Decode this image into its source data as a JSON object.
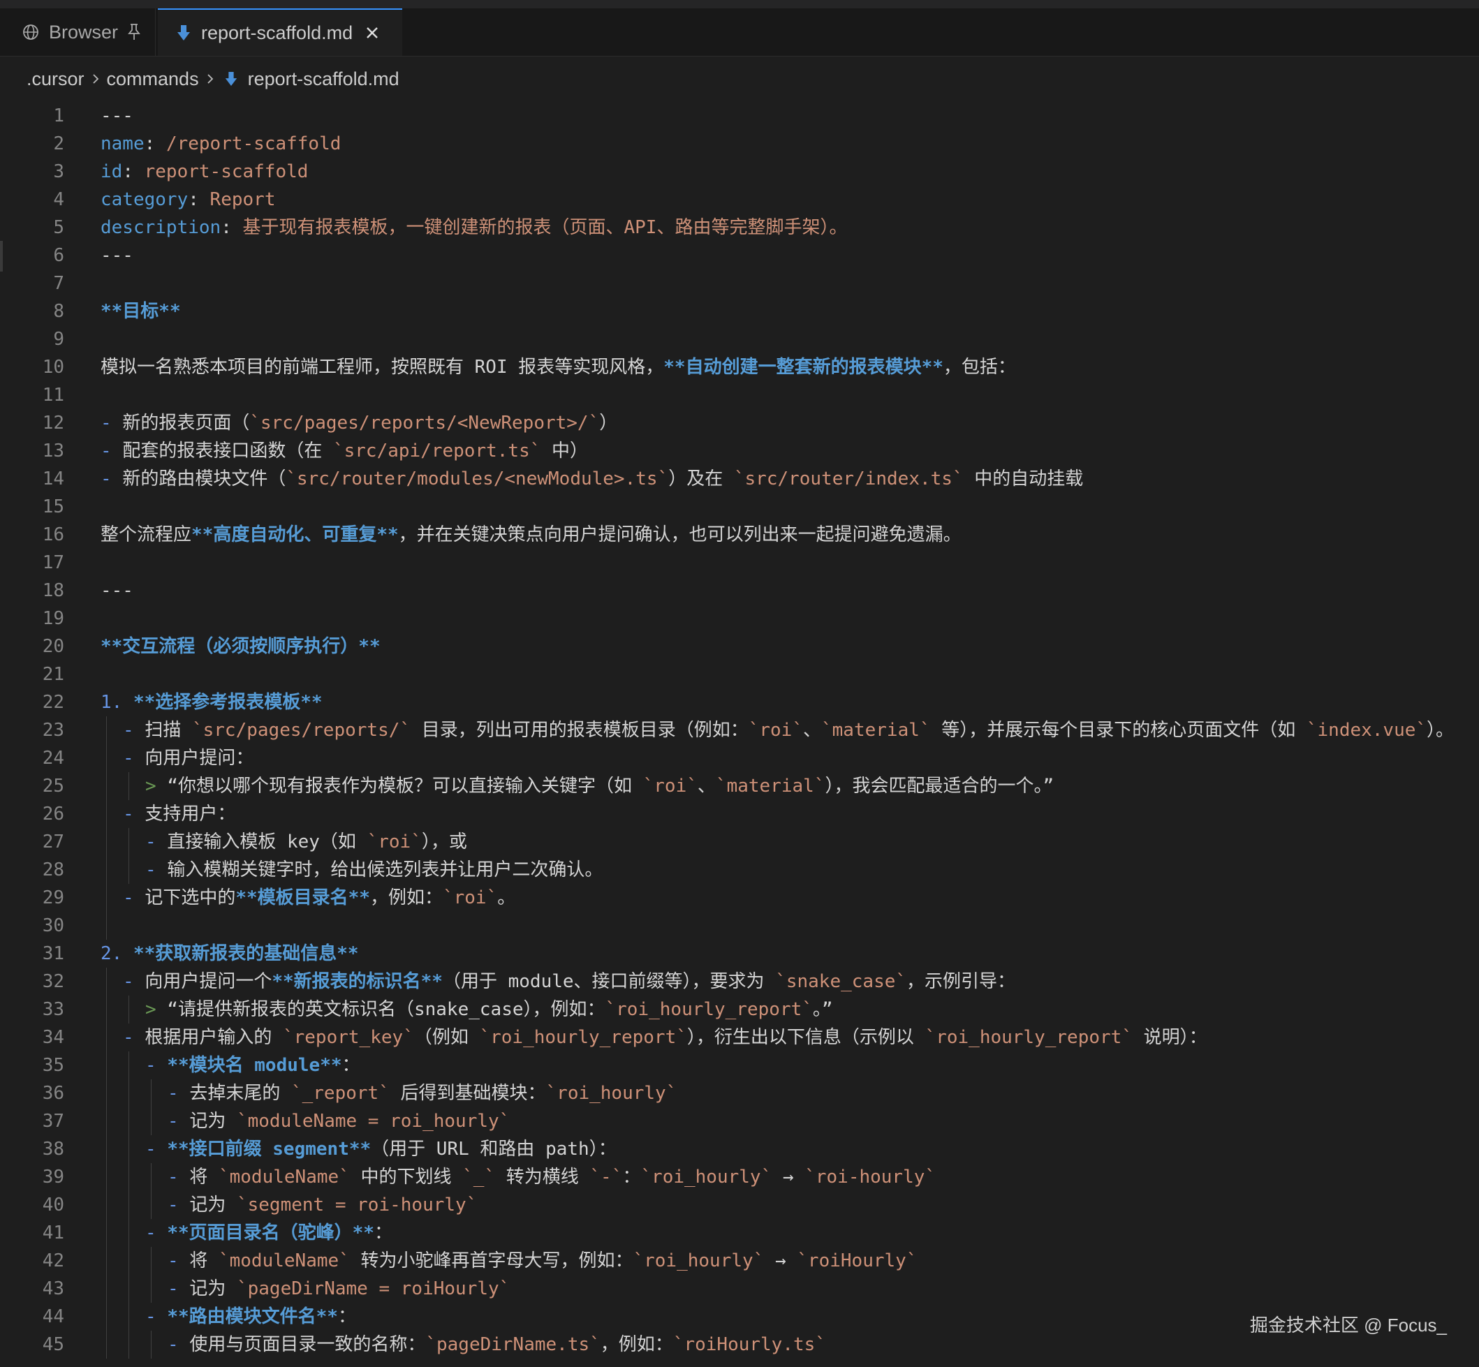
{
  "tabs": [
    {
      "label": "Browser",
      "icon": "globe-icon",
      "pinned": true,
      "active": false
    },
    {
      "label": "report-scaffold.md",
      "icon": "markdown-icon",
      "active": true
    }
  ],
  "breadcrumb": [
    ".cursor",
    "commands",
    "report-scaffold.md"
  ],
  "watermark": "掘金技术社区 @ Focus_",
  "colors": {
    "background": "#1e1e1e",
    "keyword": "#569cd6",
    "string": "#ce9178",
    "line_number": "#858585",
    "blockquote": "#6a9955",
    "active_tab_border": "#3794ff"
  },
  "lines": [
    {
      "n": "1",
      "indent": 0,
      "segs": [
        {
          "t": "---",
          "c": "plain"
        }
      ]
    },
    {
      "n": "2",
      "indent": 0,
      "segs": [
        {
          "t": "name",
          "c": "key"
        },
        {
          "t": ": ",
          "c": "plain"
        },
        {
          "t": "/report-scaffold",
          "c": "str"
        }
      ]
    },
    {
      "n": "3",
      "indent": 0,
      "segs": [
        {
          "t": "id",
          "c": "key"
        },
        {
          "t": ": ",
          "c": "plain"
        },
        {
          "t": "report-scaffold",
          "c": "str"
        }
      ]
    },
    {
      "n": "4",
      "indent": 0,
      "segs": [
        {
          "t": "category",
          "c": "key"
        },
        {
          "t": ": ",
          "c": "plain"
        },
        {
          "t": "Report",
          "c": "str"
        }
      ]
    },
    {
      "n": "5",
      "indent": 0,
      "segs": [
        {
          "t": "description",
          "c": "key"
        },
        {
          "t": ": ",
          "c": "plain"
        },
        {
          "t": "基于现有报表模板，一键创建新的报表（页面、API、路由等完整脚手架）。",
          "c": "str"
        }
      ]
    },
    {
      "n": "6",
      "indent": 0,
      "segs": [
        {
          "t": "---",
          "c": "plain"
        }
      ]
    },
    {
      "n": "7",
      "indent": 0,
      "segs": []
    },
    {
      "n": "8",
      "indent": 0,
      "segs": [
        {
          "t": "**目标**",
          "c": "bold"
        }
      ]
    },
    {
      "n": "9",
      "indent": 0,
      "segs": []
    },
    {
      "n": "10",
      "indent": 0,
      "segs": [
        {
          "t": "模拟一名熟悉本项目的前端工程师，按照既有 ROI 报表等实现风格，",
          "c": "plain"
        },
        {
          "t": "**自动创建一整套新的报表模块**",
          "c": "bold"
        },
        {
          "t": "，包括：",
          "c": "plain"
        }
      ]
    },
    {
      "n": "11",
      "indent": 0,
      "segs": []
    },
    {
      "n": "12",
      "indent": 0,
      "segs": [
        {
          "t": "- ",
          "c": "dash"
        },
        {
          "t": "新的报表页面（",
          "c": "plain"
        },
        {
          "t": "`src/pages/reports/<NewReport>/`",
          "c": "code"
        },
        {
          "t": "）",
          "c": "plain"
        }
      ]
    },
    {
      "n": "13",
      "indent": 0,
      "segs": [
        {
          "t": "- ",
          "c": "dash"
        },
        {
          "t": "配套的报表接口函数（在 ",
          "c": "plain"
        },
        {
          "t": "`src/api/report.ts`",
          "c": "code"
        },
        {
          "t": " 中）",
          "c": "plain"
        }
      ]
    },
    {
      "n": "14",
      "indent": 0,
      "segs": [
        {
          "t": "- ",
          "c": "dash"
        },
        {
          "t": "新的路由模块文件（",
          "c": "plain"
        },
        {
          "t": "`src/router/modules/<newModule>.ts`",
          "c": "code"
        },
        {
          "t": "）及在 ",
          "c": "plain"
        },
        {
          "t": "`src/router/index.ts`",
          "c": "code"
        },
        {
          "t": " 中的自动挂载",
          "c": "plain"
        }
      ]
    },
    {
      "n": "15",
      "indent": 0,
      "segs": []
    },
    {
      "n": "16",
      "indent": 0,
      "segs": [
        {
          "t": "整个流程应",
          "c": "plain"
        },
        {
          "t": "**高度自动化、可重复**",
          "c": "bold"
        },
        {
          "t": "，并在关键决策点向用户提问确认，也可以列出来一起提问避免遗漏。",
          "c": "plain"
        }
      ]
    },
    {
      "n": "17",
      "indent": 0,
      "segs": []
    },
    {
      "n": "18",
      "indent": 0,
      "segs": [
        {
          "t": "---",
          "c": "plain"
        }
      ]
    },
    {
      "n": "19",
      "indent": 0,
      "segs": []
    },
    {
      "n": "20",
      "indent": 0,
      "segs": [
        {
          "t": "**交互流程（必须按顺序执行）**",
          "c": "bold"
        }
      ]
    },
    {
      "n": "21",
      "indent": 0,
      "segs": []
    },
    {
      "n": "22",
      "indent": 0,
      "segs": [
        {
          "t": "1. ",
          "c": "dash"
        },
        {
          "t": "**选择参考报表模板**",
          "c": "bold"
        }
      ]
    },
    {
      "n": "23",
      "indent": 1,
      "segs": [
        {
          "t": "- ",
          "c": "dash"
        },
        {
          "t": "扫描 ",
          "c": "plain"
        },
        {
          "t": "`src/pages/reports/`",
          "c": "code"
        },
        {
          "t": " 目录，列出可用的报表模板目录（例如：",
          "c": "plain"
        },
        {
          "t": "`roi`",
          "c": "code"
        },
        {
          "t": "、",
          "c": "plain"
        },
        {
          "t": "`material`",
          "c": "code"
        },
        {
          "t": " 等），并展示每个目录下的核心页面文件（如 ",
          "c": "plain"
        },
        {
          "t": "`index.vue`",
          "c": "code"
        },
        {
          "t": "）。",
          "c": "plain"
        }
      ]
    },
    {
      "n": "24",
      "indent": 1,
      "segs": [
        {
          "t": "- ",
          "c": "dash"
        },
        {
          "t": "向用户提问：",
          "c": "plain"
        }
      ]
    },
    {
      "n": "25",
      "indent": 2,
      "segs": [
        {
          "t": "> ",
          "c": "quote"
        },
        {
          "t": "“你想以哪个现有报表作为模板？可以直接输入关键字（如 ",
          "c": "plain"
        },
        {
          "t": "`roi`",
          "c": "code"
        },
        {
          "t": "、",
          "c": "plain"
        },
        {
          "t": "`material`",
          "c": "code"
        },
        {
          "t": "），我会匹配最适合的一个。”",
          "c": "plain"
        }
      ]
    },
    {
      "n": "26",
      "indent": 1,
      "segs": [
        {
          "t": "- ",
          "c": "dash"
        },
        {
          "t": "支持用户：",
          "c": "plain"
        }
      ]
    },
    {
      "n": "27",
      "indent": 2,
      "segs": [
        {
          "t": "- ",
          "c": "dash"
        },
        {
          "t": "直接输入模板 key（如 ",
          "c": "plain"
        },
        {
          "t": "`roi`",
          "c": "code"
        },
        {
          "t": "），或",
          "c": "plain"
        }
      ]
    },
    {
      "n": "28",
      "indent": 2,
      "segs": [
        {
          "t": "- ",
          "c": "dash"
        },
        {
          "t": "输入模糊关键字时，给出候选列表并让用户二次确认。",
          "c": "plain"
        }
      ]
    },
    {
      "n": "29",
      "indent": 1,
      "segs": [
        {
          "t": "- ",
          "c": "dash"
        },
        {
          "t": "记下选中的",
          "c": "plain"
        },
        {
          "t": "**模板目录名**",
          "c": "bold"
        },
        {
          "t": "，例如：",
          "c": "plain"
        },
        {
          "t": "`roi`",
          "c": "code"
        },
        {
          "t": "。",
          "c": "plain"
        }
      ]
    },
    {
      "n": "30",
      "indent": 1,
      "segs": []
    },
    {
      "n": "31",
      "indent": 0,
      "segs": [
        {
          "t": "2. ",
          "c": "dash"
        },
        {
          "t": "**获取新报表的基础信息**",
          "c": "bold"
        }
      ]
    },
    {
      "n": "32",
      "indent": 1,
      "segs": [
        {
          "t": "- ",
          "c": "dash"
        },
        {
          "t": "向用户提问一个",
          "c": "plain"
        },
        {
          "t": "**新报表的标识名**",
          "c": "bold"
        },
        {
          "t": "（用于 module、接口前缀等），要求为 ",
          "c": "plain"
        },
        {
          "t": "`snake_case`",
          "c": "code"
        },
        {
          "t": "，示例引导：",
          "c": "plain"
        }
      ]
    },
    {
      "n": "33",
      "indent": 2,
      "segs": [
        {
          "t": "> ",
          "c": "quote"
        },
        {
          "t": "“请提供新报表的英文标识名（snake_case），例如：",
          "c": "plain"
        },
        {
          "t": "`roi_hourly_report`",
          "c": "code"
        },
        {
          "t": "。”",
          "c": "plain"
        }
      ]
    },
    {
      "n": "34",
      "indent": 1,
      "segs": [
        {
          "t": "- ",
          "c": "dash"
        },
        {
          "t": "根据用户输入的 ",
          "c": "plain"
        },
        {
          "t": "`report_key`",
          "c": "code"
        },
        {
          "t": "（例如 ",
          "c": "plain"
        },
        {
          "t": "`roi_hourly_report`",
          "c": "code"
        },
        {
          "t": "），衍生出以下信息（示例以 ",
          "c": "plain"
        },
        {
          "t": "`roi_hourly_report`",
          "c": "code"
        },
        {
          "t": " 说明）：",
          "c": "plain"
        }
      ]
    },
    {
      "n": "35",
      "indent": 2,
      "segs": [
        {
          "t": "- ",
          "c": "dash"
        },
        {
          "t": "**模块名 module**",
          "c": "bold"
        },
        {
          "t": "：",
          "c": "plain"
        }
      ]
    },
    {
      "n": "36",
      "indent": 3,
      "segs": [
        {
          "t": "- ",
          "c": "dash"
        },
        {
          "t": "去掉末尾的 ",
          "c": "plain"
        },
        {
          "t": "`_report`",
          "c": "code"
        },
        {
          "t": " 后得到基础模块：",
          "c": "plain"
        },
        {
          "t": "`roi_hourly`",
          "c": "code"
        }
      ]
    },
    {
      "n": "37",
      "indent": 3,
      "segs": [
        {
          "t": "- ",
          "c": "dash"
        },
        {
          "t": "记为 ",
          "c": "plain"
        },
        {
          "t": "`moduleName = roi_hourly`",
          "c": "code"
        }
      ]
    },
    {
      "n": "38",
      "indent": 2,
      "segs": [
        {
          "t": "- ",
          "c": "dash"
        },
        {
          "t": "**接口前缀 segment**",
          "c": "bold"
        },
        {
          "t": "（用于 URL 和路由 path）：",
          "c": "plain"
        }
      ]
    },
    {
      "n": "39",
      "indent": 3,
      "segs": [
        {
          "t": "- ",
          "c": "dash"
        },
        {
          "t": "将 ",
          "c": "plain"
        },
        {
          "t": "`moduleName`",
          "c": "code"
        },
        {
          "t": " 中的下划线 ",
          "c": "plain"
        },
        {
          "t": "`_`",
          "c": "code"
        },
        {
          "t": " 转为横线 ",
          "c": "plain"
        },
        {
          "t": "`-`",
          "c": "code"
        },
        {
          "t": "：",
          "c": "plain"
        },
        {
          "t": "`roi_hourly`",
          "c": "code"
        },
        {
          "t": " → ",
          "c": "plain"
        },
        {
          "t": "`roi-hourly`",
          "c": "code"
        }
      ]
    },
    {
      "n": "40",
      "indent": 3,
      "segs": [
        {
          "t": "- ",
          "c": "dash"
        },
        {
          "t": "记为 ",
          "c": "plain"
        },
        {
          "t": "`segment = roi-hourly`",
          "c": "code"
        }
      ]
    },
    {
      "n": "41",
      "indent": 2,
      "segs": [
        {
          "t": "- ",
          "c": "dash"
        },
        {
          "t": "**页面目录名（驼峰）**",
          "c": "bold"
        },
        {
          "t": "：",
          "c": "plain"
        }
      ]
    },
    {
      "n": "42",
      "indent": 3,
      "segs": [
        {
          "t": "- ",
          "c": "dash"
        },
        {
          "t": "将 ",
          "c": "plain"
        },
        {
          "t": "`moduleName`",
          "c": "code"
        },
        {
          "t": " 转为小驼峰再首字母大写，例如：",
          "c": "plain"
        },
        {
          "t": "`roi_hourly`",
          "c": "code"
        },
        {
          "t": " → ",
          "c": "plain"
        },
        {
          "t": "`roiHourly`",
          "c": "code"
        }
      ]
    },
    {
      "n": "43",
      "indent": 3,
      "segs": [
        {
          "t": "- ",
          "c": "dash"
        },
        {
          "t": "记为 ",
          "c": "plain"
        },
        {
          "t": "`pageDirName = roiHourly`",
          "c": "code"
        }
      ]
    },
    {
      "n": "44",
      "indent": 2,
      "segs": [
        {
          "t": "- ",
          "c": "dash"
        },
        {
          "t": "**路由模块文件名**",
          "c": "bold"
        },
        {
          "t": "：",
          "c": "plain"
        }
      ]
    },
    {
      "n": "45",
      "indent": 3,
      "segs": [
        {
          "t": "- ",
          "c": "dash"
        },
        {
          "t": "使用与页面目录一致的名称：",
          "c": "plain"
        },
        {
          "t": "`pageDirName.ts`",
          "c": "code"
        },
        {
          "t": "，例如：",
          "c": "plain"
        },
        {
          "t": "`roiHourly.ts`",
          "c": "code"
        }
      ]
    }
  ]
}
